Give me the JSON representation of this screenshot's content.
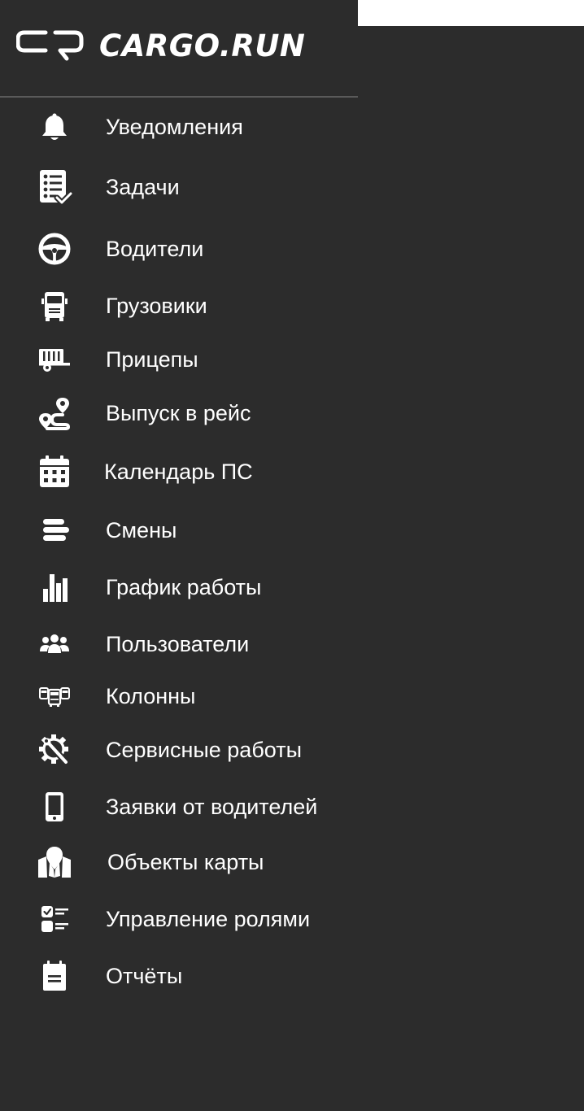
{
  "brand": {
    "name": "CARGO.RUN"
  },
  "colors": {
    "sidebar_bg": "#2c2c2c",
    "text": "#ffffff",
    "divider": "#5a5a5a",
    "top_strip": "#ffffff"
  },
  "menu": [
    {
      "label": "Уведомления",
      "icon": "bell-icon"
    },
    {
      "label": "Задачи",
      "icon": "task-list-icon"
    },
    {
      "label": "Водители",
      "icon": "steering-wheel-icon"
    },
    {
      "label": "Грузовики",
      "icon": "truck-icon"
    },
    {
      "label": "Прицепы",
      "icon": "trailer-icon"
    },
    {
      "label": "Выпуск в рейс",
      "icon": "route-icon"
    },
    {
      "label": "Календарь ПС",
      "icon": "calendar-icon"
    },
    {
      "label": "Смены",
      "icon": "stream-icon"
    },
    {
      "label": "График работы",
      "icon": "bar-chart-icon"
    },
    {
      "label": "Пользователи",
      "icon": "users-icon"
    },
    {
      "label": "Колонны",
      "icon": "convoy-icon"
    },
    {
      "label": "Сервисные работы",
      "icon": "gear-wrench-icon"
    },
    {
      "label": "Заявки от водителей",
      "icon": "mobile-phone-icon"
    },
    {
      "label": "Объекты карты",
      "icon": "map-marker-icon"
    },
    {
      "label": "Управление ролями",
      "icon": "checklist-icon"
    },
    {
      "label": "Отчёты",
      "icon": "clipboard-icon"
    }
  ]
}
